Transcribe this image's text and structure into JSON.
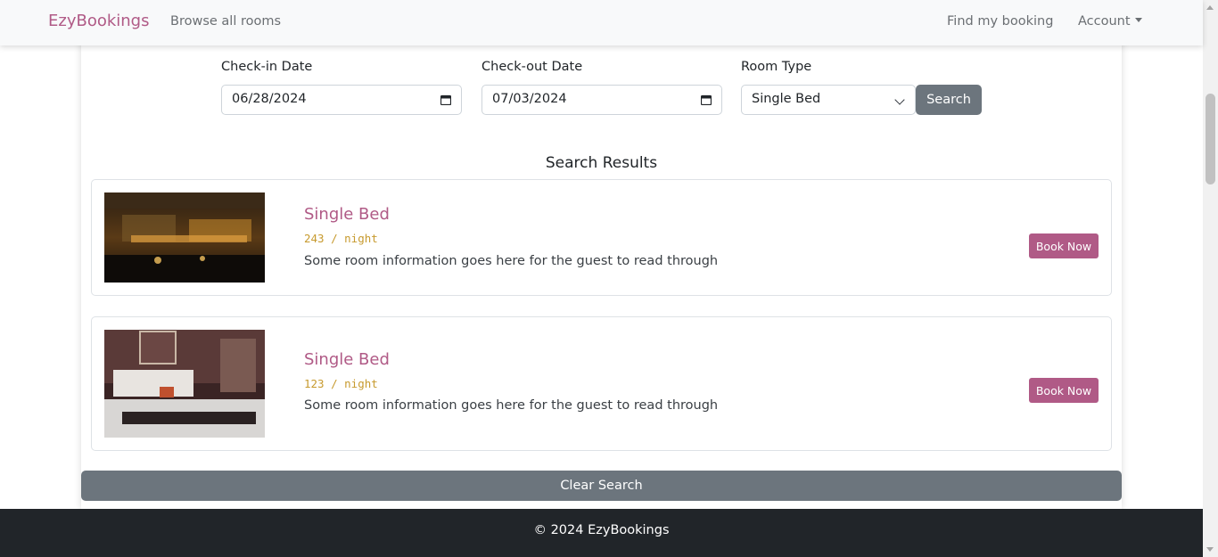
{
  "nav": {
    "brand": "EzyBookings",
    "browse": "Browse all rooms",
    "find": "Find my booking",
    "account": "Account"
  },
  "form": {
    "checkin_label": "Check-in Date",
    "checkin_value": "06/28/2024",
    "checkout_label": "Check-out Date",
    "checkout_value": "07/03/2024",
    "roomtype_label": "Room Type",
    "roomtype_value": "Single Bed",
    "search_label": "Search"
  },
  "results": {
    "title": "Search Results",
    "items": [
      {
        "name": "Single Bed",
        "price": "243 / night",
        "desc": "Some room information goes here for the guest to read through",
        "button": "Book Now"
      },
      {
        "name": "Single Bed",
        "price": "123 / night",
        "desc": "Some room information goes here for the guest to read through",
        "button": "Book Now"
      }
    ]
  },
  "clear_label": "Clear Search",
  "footer": "© 2024 EzyBookings",
  "colors": {
    "brand": "#b05a86",
    "price": "#c79a2e",
    "secondary": "#6c757d",
    "footer": "#212529"
  }
}
